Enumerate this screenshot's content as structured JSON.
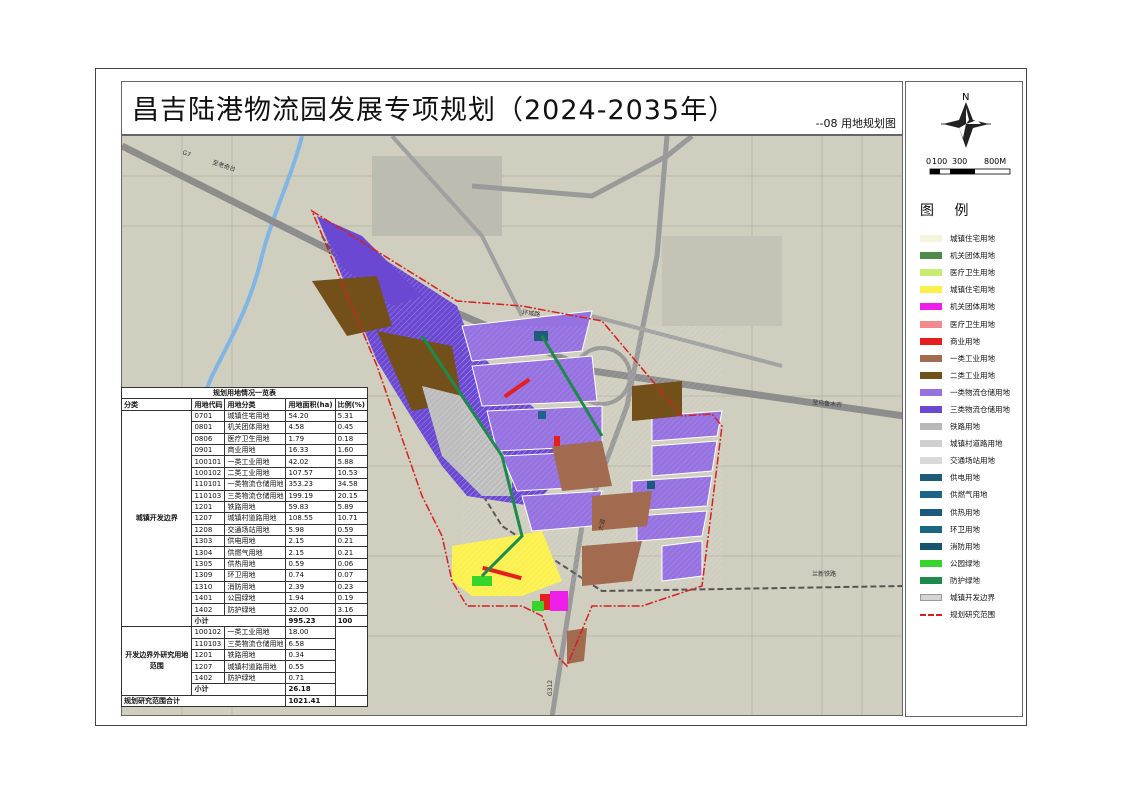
{
  "header": {
    "title": "昌吉陆港物流园发展专项规划（2024-2035年）",
    "subtitle": "--08 用地规划图"
  },
  "compass": {
    "north_label": "N"
  },
  "scale_bar": {
    "labels": [
      "0",
      "100",
      "300",
      "800M"
    ]
  },
  "legend": {
    "title": "图 例",
    "items": [
      {
        "label": "城镇住宅用地",
        "color": "#f4f5dc"
      },
      {
        "label": "机关团体用地",
        "color": "#4e8a4a"
      },
      {
        "label": "医疗卫生用地",
        "color": "#c8ec72"
      },
      {
        "label": "城镇住宅用地",
        "color": "#fbf04c"
      },
      {
        "label": "机关团体用地",
        "color": "#ee1fe8"
      },
      {
        "label": "医疗卫生用地",
        "color": "#f08a8c"
      },
      {
        "label": "商业用地",
        "color": "#e61e1e"
      },
      {
        "label": "一类工业用地",
        "color": "#a26a4e"
      },
      {
        "label": "二类工业用地",
        "color": "#73501a"
      },
      {
        "label": "一类物流仓储用地",
        "color": "#9672e0"
      },
      {
        "label": "三类物流仓储用地",
        "color": "#6a48d2"
      },
      {
        "label": "铁路用地",
        "color": "#b8b8b8"
      },
      {
        "label": "城镇村道路用地",
        "color": "#cfcfcf"
      },
      {
        "label": "交通场站用地",
        "color": "#d9d9d9"
      },
      {
        "label": "供电用地",
        "color": "#1f5c7a"
      },
      {
        "label": "供燃气用地",
        "color": "#1c6488"
      },
      {
        "label": "供热用地",
        "color": "#1a5a7e"
      },
      {
        "label": "环卫用地",
        "color": "#1b6680"
      },
      {
        "label": "消防用地",
        "color": "#18546e"
      },
      {
        "label": "公园绿地",
        "color": "#37d52b"
      },
      {
        "label": "防护绿地",
        "color": "#1d8a4c"
      },
      {
        "label": "城镇开发边界",
        "color": "#d4d4d4"
      },
      {
        "label": "规划研究范围",
        "color": "#d62020"
      }
    ]
  },
  "map": {
    "labels": {
      "g7_highway": "G7",
      "ring_road": "环城路",
      "dadao": "大道",
      "rail": "兰新铁路",
      "bottom_road": "G312",
      "upper_road": "至老奇台",
      "right_road": "至乌鲁木齐"
    }
  },
  "table": {
    "caption": "规划用地情况一览表",
    "headers": [
      "分类",
      "用地代码",
      "用地分类",
      "用地面积(ha)",
      "比例(%)"
    ],
    "group1": {
      "name": "城镇开发边界",
      "rows": [
        [
          "0701",
          "城镇住宅用地",
          "54.20",
          "5.31"
        ],
        [
          "0801",
          "机关团体用地",
          "4.58",
          "0.45"
        ],
        [
          "0806",
          "医疗卫生用地",
          "1.79",
          "0.18"
        ],
        [
          "0901",
          "商业用地",
          "16.33",
          "1.60"
        ],
        [
          "100101",
          "一类工业用地",
          "42.02",
          "5.88"
        ],
        [
          "100102",
          "二类工业用地",
          "107.57",
          "10.53"
        ],
        [
          "110101",
          "一类物流仓储用地",
          "353.23",
          "34.58"
        ],
        [
          "110103",
          "三类物流仓储用地",
          "199.19",
          "20.15"
        ],
        [
          "1201",
          "铁路用地",
          "59.83",
          "5.89"
        ],
        [
          "1207",
          "城镇村道路用地",
          "108.55",
          "10.71"
        ],
        [
          "1208",
          "交通场站用地",
          "5.98",
          "0.59"
        ],
        [
          "1303",
          "供电用地",
          "2.15",
          "0.21"
        ],
        [
          "1304",
          "供燃气用地",
          "2.15",
          "0.21"
        ],
        [
          "1305",
          "供热用地",
          "0.59",
          "0.06"
        ],
        [
          "1309",
          "环卫用地",
          "0.74",
          "0.07"
        ],
        [
          "1310",
          "消防用地",
          "2.39",
          "0.23"
        ],
        [
          "1401",
          "公园绿地",
          "1.94",
          "0.19"
        ],
        [
          "1402",
          "防护绿地",
          "32.00",
          "3.16"
        ]
      ],
      "subtotal_label": "小计",
      "subtotal_area": "995.23",
      "subtotal_ratio": "100"
    },
    "group2": {
      "name": "开发边界外研究用地范围",
      "rows": [
        [
          "100102",
          "一类工业用地",
          "18.00"
        ],
        [
          "110103",
          "三类物流仓储用地",
          "6.58"
        ],
        [
          "1201",
          "铁路用地",
          "0.34"
        ],
        [
          "1207",
          "城镇村道路用地",
          "0.55"
        ],
        [
          "1402",
          "防护绿地",
          "0.71"
        ]
      ],
      "subtotal_label": "小计",
      "subtotal_area": "26.18"
    },
    "total_label": "规划研究范围合计",
    "total_area": "1021.41"
  }
}
